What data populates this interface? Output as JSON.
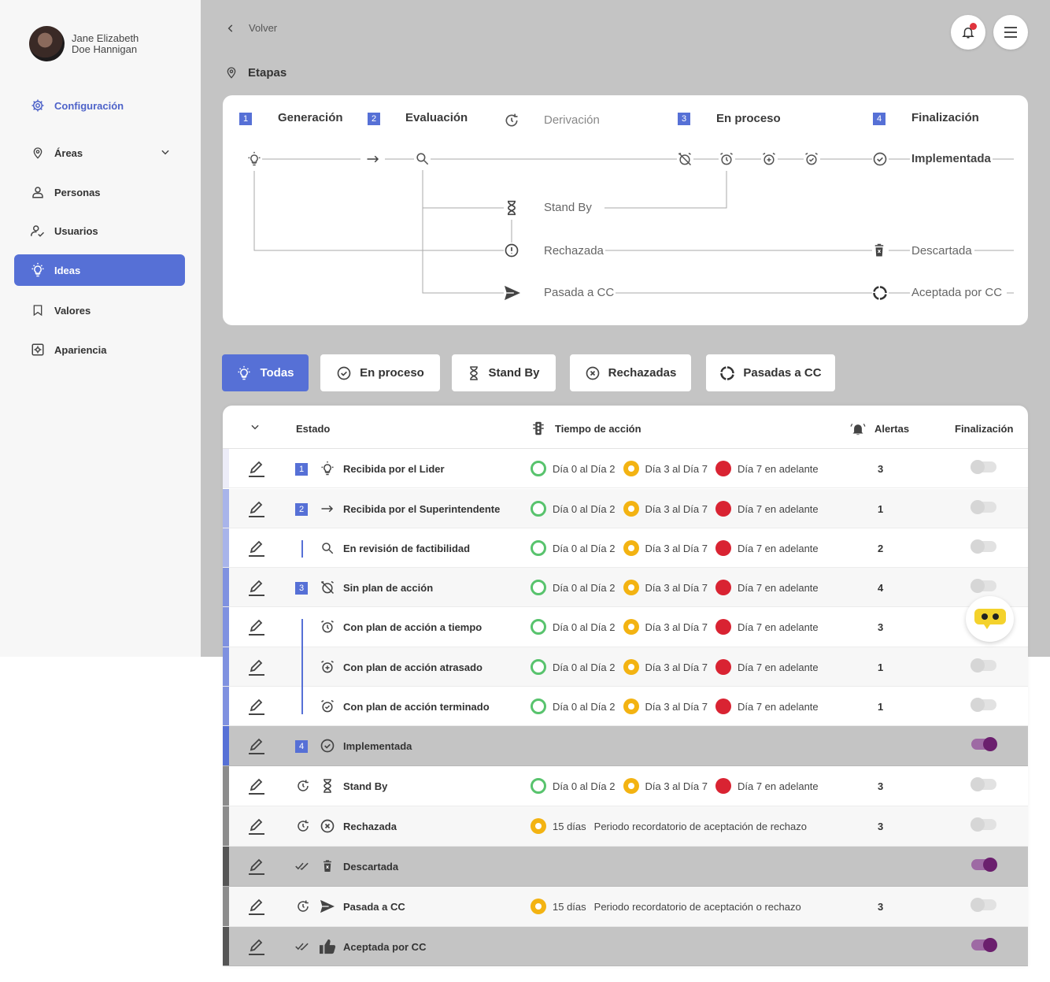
{
  "user": {
    "name_line1": "Jane Elizabeth",
    "name_line2": "Doe Hannigan"
  },
  "sidebar": {
    "items": [
      {
        "label": "Configuración",
        "icon": "gear-icon"
      },
      {
        "label": "Áreas",
        "icon": "location-pin-icon"
      },
      {
        "label": "Personas",
        "icon": "person-icon"
      },
      {
        "label": "Usuarios",
        "icon": "user-check-icon"
      },
      {
        "label": "Ideas",
        "icon": "lightbulb-icon",
        "active": true
      },
      {
        "label": "Valores",
        "icon": "bookmark-icon"
      },
      {
        "label": "Apariencia",
        "icon": "appearance-icon"
      }
    ]
  },
  "header": {
    "back_label": "Volver",
    "section_title": "Etapas",
    "notification_count": 1
  },
  "stages": {
    "heads": [
      {
        "num": "1",
        "label": "Generación"
      },
      {
        "num": "2",
        "label": "Evaluación"
      },
      {
        "num": "",
        "label": "Derivación"
      },
      {
        "num": "3",
        "label": "En proceso"
      },
      {
        "num": "4",
        "label": "Finalización"
      }
    ],
    "labels": {
      "implementada": "Implementada",
      "stand_by": "Stand By",
      "rechazada": "Rechazada",
      "descartada": "Descartada",
      "pasada": "Pasada a CC",
      "aceptada": "Aceptada por CC"
    }
  },
  "filters": [
    {
      "label": "Todas",
      "icon": "lightbulb-icon",
      "active": true
    },
    {
      "label": "En proceso",
      "icon": "check-circle-icon"
    },
    {
      "label": "Stand By",
      "icon": "hourglass-icon"
    },
    {
      "label": "Rechazadas",
      "icon": "x-circle-icon"
    },
    {
      "label": "Pasadas a CC",
      "icon": "circle-refresh-icon"
    }
  ],
  "table": {
    "headers": {
      "estado": "Estado",
      "tiempo": "Tiempo de acción",
      "alertas": "Alertas",
      "finalizacion": "Finalización"
    },
    "time_labels": {
      "green": "Día 0 al Día 2",
      "yellow": "Día 3 al Día 7",
      "red": "Día 7 en adelante"
    },
    "rows": [
      {
        "label": "Recibida por el Lider",
        "num": "1",
        "icon": "lightbulb-icon",
        "alerts": "3",
        "finalized": false
      },
      {
        "label": "Recibida por el Superintendente",
        "num": "2",
        "icon": "arrow-right-icon",
        "alerts": "1",
        "finalized": false
      },
      {
        "label": "En revisión de factibilidad",
        "icon": "search-icon",
        "alerts": "2",
        "finalized": false
      },
      {
        "label": "Sin plan de acción",
        "num": "3",
        "icon": "alarm-off-icon",
        "alerts": "4",
        "finalized": false
      },
      {
        "label": "Con plan de acción a tiempo",
        "icon": "alarm-icon",
        "alerts": "3",
        "finalized": false
      },
      {
        "label": "Con plan de acción atrasado",
        "icon": "alarm-plus-icon",
        "alerts": "1",
        "finalized": false
      },
      {
        "label": "Con plan de acción terminado",
        "icon": "alarm-check-icon",
        "alerts": "1",
        "finalized": false
      },
      {
        "label": "Implementada",
        "num": "4",
        "icon": "check-circle-icon",
        "finalized": true
      },
      {
        "label": "Stand By",
        "icon": "hourglass-icon",
        "alerts": "3",
        "finalized": false
      },
      {
        "label": "Rechazada",
        "icon": "x-circle-icon",
        "days": "15 días",
        "note": "Periodo recordatorio de aceptación de rechazo",
        "alerts": "3",
        "finalized": false
      },
      {
        "label": "Descartada",
        "icon": "trash-icon",
        "finalized": true
      },
      {
        "label": "Pasada a CC",
        "icon": "send-icon",
        "days": "15 días",
        "note": "Periodo recordatorio de aceptación o rechazo",
        "alerts": "3",
        "finalized": false
      },
      {
        "label": "Aceptada por CC",
        "icon": "thumbs-up-icon",
        "finalized": true
      }
    ]
  }
}
